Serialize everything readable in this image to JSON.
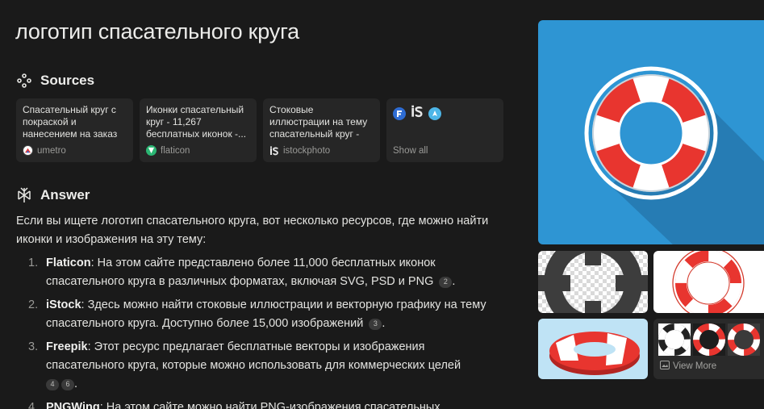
{
  "query": "логотип спасательного круга",
  "sources_heading": "Sources",
  "sources": [
    {
      "title": "Спасательный круг с покраской и нанесением на заказ",
      "site": "umetro"
    },
    {
      "title": "Иконки спасательный круг - 11,267 бесплатных иконок -...",
      "site": "flaticon"
    },
    {
      "title": "Стоковые иллюстрации на тему спасательный круг - iStock",
      "site": "istockphoto"
    }
  ],
  "show_all": "Show all",
  "answer_heading": "Answer",
  "answer_intro": "Если вы ищете логотип спасательного круга, вот несколько ресурсов, где можно найти иконки и изображения на эту тему:",
  "answer_items": [
    {
      "num": "1.",
      "name": "Flaticon",
      "text": ": На этом сайте представлено более 11,000 бесплатных иконок спасательного круга в различных форматах, включая SVG, PSD и PNG",
      "cites": [
        "2"
      ]
    },
    {
      "num": "2.",
      "name": "iStock",
      "text": ": Здесь можно найти стоковые иллюстрации и векторную графику на тему спасательного круга. Доступно более 15,000 изображений",
      "cites": [
        "3"
      ]
    },
    {
      "num": "3.",
      "name": "Freepik",
      "text": ": Этот ресурс предлагает бесплатные векторы и изображения спасательного круга, которые можно использовать для коммерческих целей",
      "cites": [
        "4",
        "6"
      ]
    },
    {
      "num": "4.",
      "name": "PNGWing",
      "text": ": На этом сайте можно найти PNG-изображения спасательных",
      "cites": []
    }
  ],
  "view_more": "View More",
  "colors": {
    "background": "#1a1a1a",
    "card": "#262626",
    "lifebuoy_red": "#e8352f",
    "image_blue": "#2e95d3"
  }
}
